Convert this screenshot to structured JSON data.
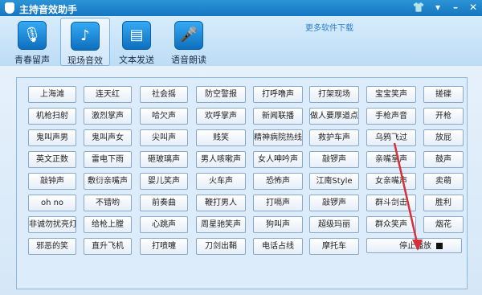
{
  "window": {
    "title": "主持音效助手"
  },
  "toolbar": {
    "tools": [
      {
        "label": "青春留声"
      },
      {
        "label": "现场音效"
      },
      {
        "label": "文本发送"
      },
      {
        "label": "语音朗读"
      }
    ],
    "more_link": "更多软件下载"
  },
  "sound_buttons": [
    [
      "上海滩",
      "连天红",
      "社会摇",
      "防空警报",
      "打呼噜声",
      "打架现场",
      "宝宝笑声",
      "搓碟"
    ],
    [
      "机枪扫射",
      "激烈掌声",
      "哈欠声",
      "欢呼掌声",
      "新闻联播",
      "做人要厚道点",
      "手枪声音",
      "开枪"
    ],
    [
      "鬼叫声男",
      "鬼叫声女",
      "尖叫声",
      "贱笑",
      "精神病院热线",
      "救护车声",
      "乌鸦飞过",
      "放屁"
    ],
    [
      "英文正数",
      "雷电下雨",
      "砸玻璃声",
      "男人咳嗽声",
      "女人呻吟声",
      "敲锣声",
      "亲嘴掌声",
      "鼓声"
    ],
    [
      "敲钟声",
      "敷衍亲嘴声",
      "婴儿笑声",
      "火车声",
      "恐怖声",
      "江南Style",
      "女亲嘴声",
      "卖萌"
    ],
    [
      "oh no",
      "不错哟",
      "前奏曲",
      "鞭打男人",
      "打嗝声",
      "敲锣声",
      "群斗剑击",
      "胜利"
    ],
    [
      "非诚勿扰亮灯",
      "给枪上膛",
      "心跳声",
      "周星驰笑声",
      "狗叫声",
      "超级玛丽",
      "群众笑声",
      "烟花"
    ],
    [
      "邪恶的笑",
      "直升飞机",
      "打喷嚏",
      "刀剑出鞘",
      "电话占线",
      "摩托车"
    ]
  ],
  "stop_button": {
    "label": "停止播放"
  },
  "colors": {
    "title_bar": "#1a80c8",
    "accent_arrow": "#d8303b"
  }
}
